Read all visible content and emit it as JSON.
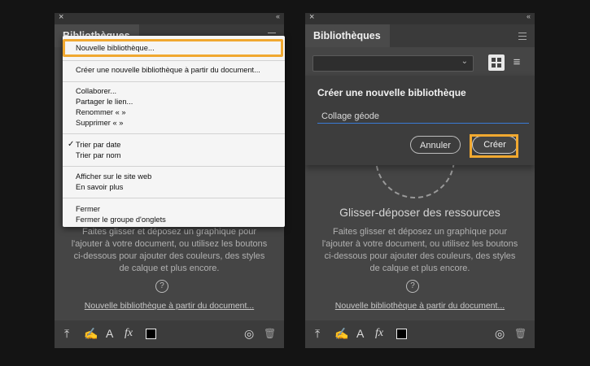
{
  "left_panel": {
    "tab_label": "Bibliothèques",
    "drop_description": "Faites glisser et déposez un graphique pour l'ajouter à votre document, ou utilisez les boutons ci-dessous pour ajouter des couleurs, des styles de calque et plus encore.",
    "help_glyph": "?",
    "link_label": "Nouvelle bibliothèque à partir du document..."
  },
  "menu": {
    "items": [
      "Nouvelle bibliothèque...",
      "Créer une nouvelle bibliothèque à partir du document...",
      "Collaborer...",
      "Partager le lien...",
      "Renommer « »",
      "Supprimer « »",
      "Trier par date",
      "Trier par nom",
      "Afficher sur le site web",
      "En savoir plus",
      "Fermer",
      "Fermer le groupe d'onglets"
    ],
    "checked_item": "Trier par date"
  },
  "right_panel": {
    "tab_label": "Bibliothèques",
    "dialog": {
      "title": "Créer une nouvelle bibliothèque",
      "input_value": "Collage géode",
      "cancel_label": "Annuler",
      "create_label": "Créer"
    },
    "drop_title": "Glisser-déposer des ressources",
    "drop_description": "Faites glisser et déposez un graphique pour l'ajouter à votre document, ou utilisez les boutons ci-dessous pour ajouter des couleurs, des styles de calque et plus encore.",
    "help_glyph": "?",
    "link_label": "Nouvelle bibliothèque à partir du document..."
  },
  "chrome": {
    "close_glyph": "×",
    "collapse_glyph": "‹‹",
    "chevron_glyph": "⌄",
    "check_glyph": "✓"
  },
  "footer": {
    "icons": [
      "upload-icon",
      "brush-icon",
      "text-style-icon",
      "layer-style-icon",
      "color-swatch-icon",
      "creative-cloud-icon",
      "trash-icon"
    ],
    "glyphs": {
      "upload": "⤒",
      "brush": "✍",
      "text": "A",
      "fx": "fx",
      "cc": "◎",
      "trash": "🗑"
    }
  },
  "colors": {
    "highlight": "#f0a830",
    "panel_bg": "#454545",
    "input_underline": "#3a7bd5"
  }
}
